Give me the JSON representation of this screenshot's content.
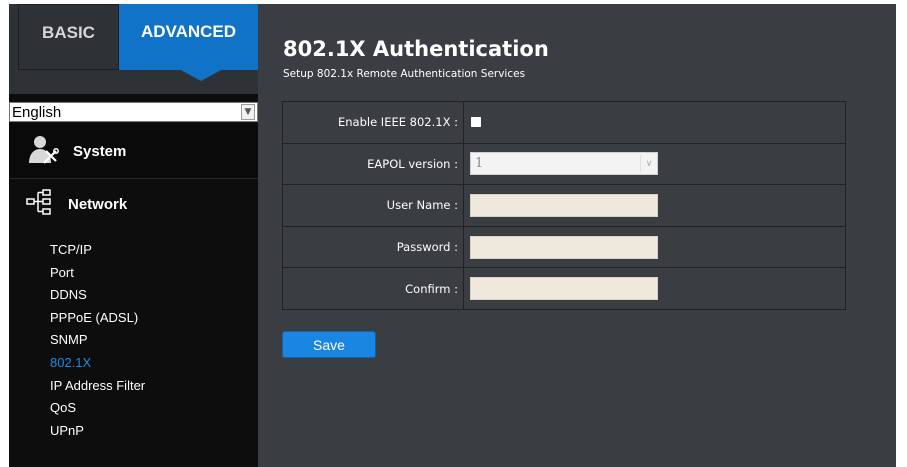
{
  "tabs": {
    "basic": "BASIC",
    "advanced": "ADVANCED"
  },
  "language": {
    "selected": "English"
  },
  "menu": {
    "system": "System",
    "network": "Network",
    "network_items": [
      "TCP/IP",
      "Port",
      "DDNS",
      "PPPoE (ADSL)",
      "SNMP",
      "802.1X",
      "IP Address Filter",
      "QoS",
      "UPnP"
    ],
    "active_item": "802.1X"
  },
  "page": {
    "title": "802.1X Authentication",
    "subtitle": "Setup 802.1x Remote Authentication Services"
  },
  "form": {
    "enable_label": "Enable IEEE 802.1X :",
    "enable_checked": false,
    "eapol_label": "EAPOL version :",
    "eapol_value": "1",
    "username_label": "User Name :",
    "username_value": "",
    "password_label": "Password :",
    "password_value": "",
    "confirm_label": "Confirm :",
    "confirm_value": ""
  },
  "buttons": {
    "save": "Save"
  },
  "colors": {
    "accent": "#1173c8",
    "active_link": "#1c8be8",
    "panel_bg": "#3a3d42"
  },
  "icons": {
    "system": "user-wrench-icon",
    "network": "network-tree-icon"
  }
}
